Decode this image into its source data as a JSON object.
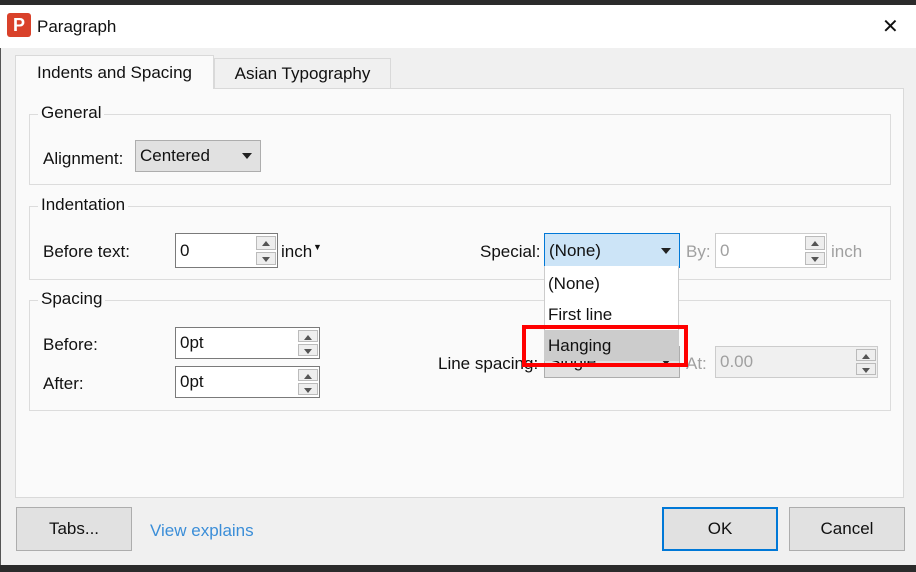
{
  "window": {
    "title": "Paragraph",
    "close": "✕"
  },
  "tabs": [
    "Indents and Spacing",
    "Asian Typography"
  ],
  "general": {
    "title": "General",
    "alignment_label": "Alignment:",
    "alignment_value": "Centered"
  },
  "indentation": {
    "title": "Indentation",
    "before_label": "Before text:",
    "before_value": "0",
    "before_unit": "inch",
    "special_label": "Special:",
    "special_value": "(None)",
    "special_options": [
      "(None)",
      "First line",
      "Hanging"
    ],
    "by_label": "By:",
    "by_value": "0",
    "by_unit": "inch"
  },
  "spacing": {
    "title": "Spacing",
    "before_label": "Before:",
    "before_value": "0pt",
    "after_label": "After:",
    "after_value": "0pt",
    "line_spacing_label": "Line spacing:",
    "line_spacing_value": "Single",
    "at_label": "At:",
    "at_value": "0.00"
  },
  "footer": {
    "tabs_button": "Tabs...",
    "link": "View explains",
    "ok": "OK",
    "cancel": "Cancel"
  },
  "colors": {
    "highlight": "#ff0000",
    "link": "#3b8ed8",
    "accent": "#0078d7"
  }
}
